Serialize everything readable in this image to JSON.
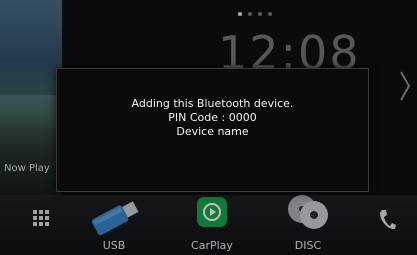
{
  "now_playing": {
    "label": "Now Play"
  },
  "clock": {
    "time": "12:08"
  },
  "dialog": {
    "line1": "Adding this Bluetooth device.",
    "line2": "PIN Code : 0000",
    "line3": "Device name"
  },
  "bottom_bar": {
    "usb_label": "USB",
    "carplay_label": "CarPlay",
    "disc_label": "DISC"
  },
  "page_indicator": {
    "count": 4,
    "active_index": 0
  },
  "colors": {
    "carplay_green": "#19a34a",
    "dialog_bg": "#0a0a0a"
  }
}
